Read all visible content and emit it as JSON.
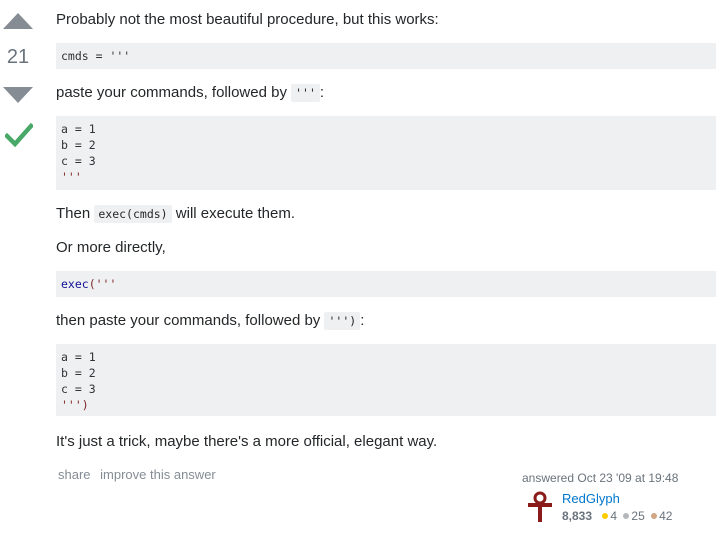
{
  "vote": {
    "count": "21",
    "up_label": "up vote",
    "down_label": "down vote"
  },
  "post": {
    "p1": "Probably not the most beautiful procedure, but this works:",
    "code1": "cmds = '''",
    "p2_before": "paste your commands, followed by ",
    "p2_code": "'''",
    "p2_after": ":",
    "code2_lines": [
      "a = 1",
      "b = 2",
      "c = 3",
      "'''"
    ],
    "p3_before": "Then ",
    "p3_code": "exec(cmds)",
    "p3_after": " will execute them.",
    "p4": "Or more directly,",
    "code3_kw": "exec",
    "code3_rest": "('''",
    "p5_before": "then paste your commands, followed by ",
    "p5_code": "''')",
    "p5_after": ":",
    "code4_lines": [
      "a = 1",
      "b = 2",
      "c = 3",
      "''')"
    ],
    "p6": "It's just a trick, maybe there's a more official, elegant way."
  },
  "menu": {
    "share": "share",
    "improve": "improve this answer"
  },
  "signature": {
    "action": "answered Oct 23 '09 at 19:48",
    "username": "RedGlyph",
    "reputation": "8,833",
    "gold": "4",
    "silver": "25",
    "bronze": "42",
    "colors": {
      "gold": "#ffcc01",
      "silver": "#b4b8bc",
      "bronze": "#d1a684"
    }
  },
  "colors": {
    "accepted": "#48a868",
    "link": "#0077cc",
    "code_bg": "#eff0f1"
  }
}
